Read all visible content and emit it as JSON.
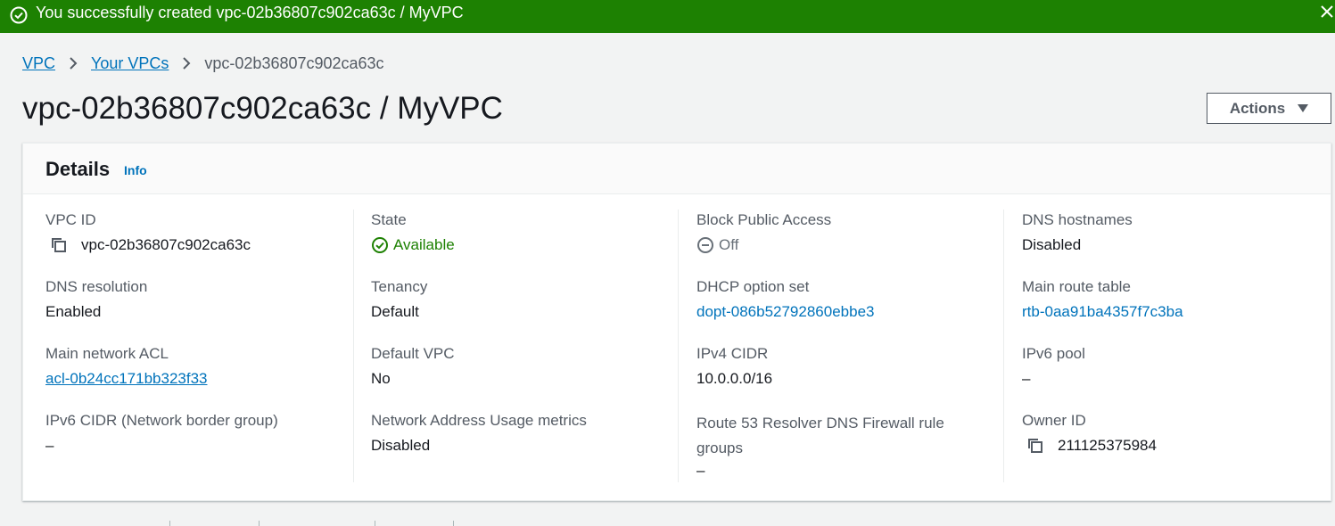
{
  "banner": {
    "message": "You successfully created vpc-02b36807c902ca63c / MyVPC",
    "color": "#1d8102"
  },
  "breadcrumb": {
    "items": [
      "VPC",
      "Your VPCs"
    ],
    "current": "vpc-02b36807c902ca63c"
  },
  "page": {
    "title": "vpc-02b36807c902ca63c / MyVPC",
    "actions_label": "Actions"
  },
  "details": {
    "heading": "Details",
    "info_label": "Info",
    "vpc_id": {
      "label": "VPC ID",
      "value": "vpc-02b36807c902ca63c"
    },
    "state": {
      "label": "State",
      "value": "Available"
    },
    "block_public_access": {
      "label": "Block Public Access",
      "value": "Off"
    },
    "dns_hostnames": {
      "label": "DNS hostnames",
      "value": "Disabled"
    },
    "dns_resolution": {
      "label": "DNS resolution",
      "value": "Enabled"
    },
    "tenancy": {
      "label": "Tenancy",
      "value": "Default"
    },
    "dhcp_option_set": {
      "label": "DHCP option set",
      "value": "dopt-086b52792860ebbe3"
    },
    "main_route_table": {
      "label": "Main route table",
      "value": "rtb-0aa91ba4357f7c3ba"
    },
    "main_network_acl": {
      "label": "Main network ACL",
      "value": "acl-0b24cc171bb323f33"
    },
    "default_vpc": {
      "label": "Default VPC",
      "value": "No"
    },
    "ipv4_cidr": {
      "label": "IPv4 CIDR",
      "value": "10.0.0.0/16"
    },
    "ipv6_pool": {
      "label": "IPv6 pool",
      "value": "–"
    },
    "ipv6_cidr": {
      "label": "IPv6 CIDR (Network border group)",
      "value": "–"
    },
    "nau_metrics": {
      "label": "Network Address Usage metrics",
      "value": "Disabled"
    },
    "route53_firewall": {
      "label": "Route 53 Resolver DNS Firewall rule groups",
      "value": "–"
    },
    "owner_id": {
      "label": "Owner ID",
      "value": "211125375984"
    }
  }
}
